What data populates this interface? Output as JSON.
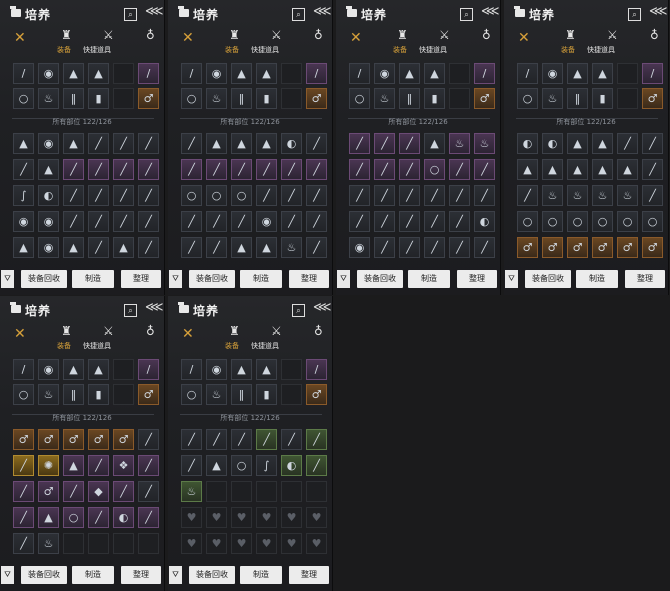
{
  "window_title": "培养",
  "categories": {
    "tab_equipment": "装备",
    "tab_quick_items": "快捷道具"
  },
  "capacity_label": "所有部位 122/126",
  "footer": {
    "recycle_label": "装备回收",
    "craft_label": "制造",
    "sort_label": "整理"
  },
  "icons": {
    "x": "✕",
    "armor": "♜",
    "sword": "⚔",
    "gourd": "♁",
    "search": "⌕",
    "collapse": "⋘",
    "filter": "⛛"
  },
  "colors": {
    "accent": "#d6a03a",
    "panel_bg": "#1f2023",
    "button_bg": "#ececec"
  },
  "panels": [
    {
      "equipped": [
        {
          "t": "dark",
          "g": "/"
        },
        {
          "t": "dark",
          "g": "◉"
        },
        {
          "t": "dark",
          "g": "▲"
        },
        {
          "t": "dark",
          "g": "▲"
        },
        {
          "t": "empty",
          "g": ""
        },
        {
          "t": "purple",
          "g": "/"
        },
        {
          "t": "dark",
          "g": "○"
        },
        {
          "t": "dark",
          "g": "♨"
        },
        {
          "t": "dark",
          "g": "‖"
        },
        {
          "t": "dark",
          "g": "▮"
        },
        {
          "t": "empty",
          "g": ""
        },
        {
          "t": "orange",
          "g": "♂"
        }
      ],
      "inventory": [
        {
          "t": "dark",
          "g": "▲"
        },
        {
          "t": "dark",
          "g": "◉"
        },
        {
          "t": "dark",
          "g": "▲"
        },
        {
          "t": "dark",
          "g": "╱"
        },
        {
          "t": "dark",
          "g": "╱"
        },
        {
          "t": "dark",
          "g": "╱"
        },
        {
          "t": "dark",
          "g": "╱"
        },
        {
          "t": "dark",
          "g": "▲"
        },
        {
          "t": "purple",
          "g": "╱"
        },
        {
          "t": "purple",
          "g": "╱"
        },
        {
          "t": "purple",
          "g": "╱"
        },
        {
          "t": "purple",
          "g": "╱"
        },
        {
          "t": "dark",
          "g": "∫"
        },
        {
          "t": "dark",
          "g": "◐"
        },
        {
          "t": "dark",
          "g": "╱"
        },
        {
          "t": "dark",
          "g": "╱"
        },
        {
          "t": "dark",
          "g": "╱"
        },
        {
          "t": "dark",
          "g": "╱"
        },
        {
          "t": "dark",
          "g": "◉"
        },
        {
          "t": "dark",
          "g": "◉"
        },
        {
          "t": "dark",
          "g": "╱"
        },
        {
          "t": "dark",
          "g": "╱"
        },
        {
          "t": "dark",
          "g": "╱"
        },
        {
          "t": "dark",
          "g": "╱"
        },
        {
          "t": "dark",
          "g": "▲"
        },
        {
          "t": "dark",
          "g": "◉"
        },
        {
          "t": "dark",
          "g": "▲"
        },
        {
          "t": "dark",
          "g": "╱"
        },
        {
          "t": "dark",
          "g": "▲"
        },
        {
          "t": "dark",
          "g": "╱"
        }
      ]
    },
    {
      "equipped": [
        {
          "t": "dark",
          "g": "/"
        },
        {
          "t": "dark",
          "g": "◉"
        },
        {
          "t": "dark",
          "g": "▲"
        },
        {
          "t": "dark",
          "g": "▲"
        },
        {
          "t": "empty",
          "g": ""
        },
        {
          "t": "purple",
          "g": "/"
        },
        {
          "t": "dark",
          "g": "○"
        },
        {
          "t": "dark",
          "g": "♨"
        },
        {
          "t": "dark",
          "g": "‖"
        },
        {
          "t": "dark",
          "g": "▮"
        },
        {
          "t": "empty",
          "g": ""
        },
        {
          "t": "orange",
          "g": "♂"
        }
      ],
      "inventory": [
        {
          "t": "dark",
          "g": "╱"
        },
        {
          "t": "dark",
          "g": "▲"
        },
        {
          "t": "dark",
          "g": "▲"
        },
        {
          "t": "dark",
          "g": "▲"
        },
        {
          "t": "dark",
          "g": "◐"
        },
        {
          "t": "dark",
          "g": "╱"
        },
        {
          "t": "purple",
          "g": "╱"
        },
        {
          "t": "purple",
          "g": "╱"
        },
        {
          "t": "purple",
          "g": "╱"
        },
        {
          "t": "purple",
          "g": "╱"
        },
        {
          "t": "purple",
          "g": "╱"
        },
        {
          "t": "purple",
          "g": "╱"
        },
        {
          "t": "dark",
          "g": "○"
        },
        {
          "t": "dark",
          "g": "○"
        },
        {
          "t": "dark",
          "g": "○"
        },
        {
          "t": "dark",
          "g": "╱"
        },
        {
          "t": "dark",
          "g": "╱"
        },
        {
          "t": "dark",
          "g": "╱"
        },
        {
          "t": "dark",
          "g": "╱"
        },
        {
          "t": "dark",
          "g": "╱"
        },
        {
          "t": "dark",
          "g": "╱"
        },
        {
          "t": "dark",
          "g": "◉"
        },
        {
          "t": "dark",
          "g": "╱"
        },
        {
          "t": "dark",
          "g": "╱"
        },
        {
          "t": "dark",
          "g": "╱"
        },
        {
          "t": "dark",
          "g": "╱"
        },
        {
          "t": "dark",
          "g": "▲"
        },
        {
          "t": "dark",
          "g": "▲"
        },
        {
          "t": "dark",
          "g": "♨"
        },
        {
          "t": "dark",
          "g": "╱"
        }
      ]
    },
    {
      "equipped": [
        {
          "t": "dark",
          "g": "/"
        },
        {
          "t": "dark",
          "g": "◉"
        },
        {
          "t": "dark",
          "g": "▲"
        },
        {
          "t": "dark",
          "g": "▲"
        },
        {
          "t": "empty",
          "g": ""
        },
        {
          "t": "purple",
          "g": "/"
        },
        {
          "t": "dark",
          "g": "○"
        },
        {
          "t": "dark",
          "g": "♨"
        },
        {
          "t": "dark",
          "g": "‖"
        },
        {
          "t": "dark",
          "g": "▮"
        },
        {
          "t": "empty",
          "g": ""
        },
        {
          "t": "orange",
          "g": "♂"
        }
      ],
      "inventory": [
        {
          "t": "purple",
          "g": "╱"
        },
        {
          "t": "purple",
          "g": "╱"
        },
        {
          "t": "purple",
          "g": "╱"
        },
        {
          "t": "dark",
          "g": "▲"
        },
        {
          "t": "purple",
          "g": "♨"
        },
        {
          "t": "purple",
          "g": "♨"
        },
        {
          "t": "purple",
          "g": "╱"
        },
        {
          "t": "purple",
          "g": "╱"
        },
        {
          "t": "purple",
          "g": "╱"
        },
        {
          "t": "purple",
          "g": "○"
        },
        {
          "t": "purple",
          "g": "╱"
        },
        {
          "t": "purple",
          "g": "╱"
        },
        {
          "t": "dark",
          "g": "╱"
        },
        {
          "t": "dark",
          "g": "╱"
        },
        {
          "t": "dark",
          "g": "╱"
        },
        {
          "t": "dark",
          "g": "╱"
        },
        {
          "t": "dark",
          "g": "╱"
        },
        {
          "t": "dark",
          "g": "╱"
        },
        {
          "t": "dark",
          "g": "╱"
        },
        {
          "t": "dark",
          "g": "╱"
        },
        {
          "t": "dark",
          "g": "╱"
        },
        {
          "t": "dark",
          "g": "╱"
        },
        {
          "t": "dark",
          "g": "╱"
        },
        {
          "t": "dark",
          "g": "◐"
        },
        {
          "t": "dark",
          "g": "◉"
        },
        {
          "t": "dark",
          "g": "╱"
        },
        {
          "t": "dark",
          "g": "╱"
        },
        {
          "t": "dark",
          "g": "╱"
        },
        {
          "t": "dark",
          "g": "╱"
        },
        {
          "t": "dark",
          "g": "╱"
        }
      ]
    },
    {
      "equipped": [
        {
          "t": "dark",
          "g": "/"
        },
        {
          "t": "dark",
          "g": "◉"
        },
        {
          "t": "dark",
          "g": "▲"
        },
        {
          "t": "dark",
          "g": "▲"
        },
        {
          "t": "empty",
          "g": ""
        },
        {
          "t": "purple",
          "g": "/"
        },
        {
          "t": "dark",
          "g": "○"
        },
        {
          "t": "dark",
          "g": "♨"
        },
        {
          "t": "dark",
          "g": "‖"
        },
        {
          "t": "dark",
          "g": "▮"
        },
        {
          "t": "empty",
          "g": ""
        },
        {
          "t": "orange",
          "g": "♂"
        }
      ],
      "inventory": [
        {
          "t": "dark",
          "g": "◐"
        },
        {
          "t": "dark",
          "g": "◐"
        },
        {
          "t": "dark",
          "g": "▲"
        },
        {
          "t": "dark",
          "g": "▲"
        },
        {
          "t": "dark",
          "g": "╱"
        },
        {
          "t": "dark",
          "g": "╱"
        },
        {
          "t": "dark",
          "g": "▲"
        },
        {
          "t": "dark",
          "g": "▲"
        },
        {
          "t": "dark",
          "g": "▲"
        },
        {
          "t": "dark",
          "g": "▲"
        },
        {
          "t": "dark",
          "g": "▲"
        },
        {
          "t": "dark",
          "g": "╱"
        },
        {
          "t": "dark",
          "g": "╱"
        },
        {
          "t": "dark",
          "g": "♨"
        },
        {
          "t": "dark",
          "g": "♨"
        },
        {
          "t": "dark",
          "g": "♨"
        },
        {
          "t": "dark",
          "g": "♨"
        },
        {
          "t": "dark",
          "g": "╱"
        },
        {
          "t": "dark",
          "g": "○"
        },
        {
          "t": "dark",
          "g": "○"
        },
        {
          "t": "dark",
          "g": "○"
        },
        {
          "t": "dark",
          "g": "○"
        },
        {
          "t": "dark",
          "g": "○"
        },
        {
          "t": "dark",
          "g": "○"
        },
        {
          "t": "orange",
          "g": "♂"
        },
        {
          "t": "orange",
          "g": "♂"
        },
        {
          "t": "orange",
          "g": "♂"
        },
        {
          "t": "orange",
          "g": "♂"
        },
        {
          "t": "orange",
          "g": "♂"
        },
        {
          "t": "orange",
          "g": "♂"
        }
      ]
    },
    {
      "equipped": [
        {
          "t": "dark",
          "g": "/"
        },
        {
          "t": "dark",
          "g": "◉"
        },
        {
          "t": "dark",
          "g": "▲"
        },
        {
          "t": "dark",
          "g": "▲"
        },
        {
          "t": "empty",
          "g": ""
        },
        {
          "t": "purple",
          "g": "/"
        },
        {
          "t": "dark",
          "g": "○"
        },
        {
          "t": "dark",
          "g": "♨"
        },
        {
          "t": "dark",
          "g": "‖"
        },
        {
          "t": "dark",
          "g": "▮"
        },
        {
          "t": "empty",
          "g": ""
        },
        {
          "t": "orange",
          "g": "♂"
        }
      ],
      "inventory": [
        {
          "t": "orange",
          "g": "♂"
        },
        {
          "t": "orange",
          "g": "♂"
        },
        {
          "t": "orange",
          "g": "♂"
        },
        {
          "t": "orange",
          "g": "♂"
        },
        {
          "t": "orange",
          "g": "♂"
        },
        {
          "t": "dark",
          "g": "╱"
        },
        {
          "t": "gold",
          "g": "╱"
        },
        {
          "t": "gold",
          "g": "✺"
        },
        {
          "t": "purple",
          "g": "▲"
        },
        {
          "t": "purple",
          "g": "╱"
        },
        {
          "t": "purple",
          "g": "❖"
        },
        {
          "t": "purple",
          "g": "╱"
        },
        {
          "t": "purple",
          "g": "╱"
        },
        {
          "t": "purple",
          "g": "♂"
        },
        {
          "t": "purple",
          "g": "╱"
        },
        {
          "t": "purple",
          "g": "◆"
        },
        {
          "t": "purple",
          "g": "╱"
        },
        {
          "t": "dark",
          "g": "╱"
        },
        {
          "t": "purple",
          "g": "╱"
        },
        {
          "t": "purple",
          "g": "▲"
        },
        {
          "t": "purple",
          "g": "○"
        },
        {
          "t": "purple",
          "g": "╱"
        },
        {
          "t": "purple",
          "g": "◐"
        },
        {
          "t": "purple",
          "g": "╱"
        },
        {
          "t": "dark",
          "g": "╱"
        },
        {
          "t": "dark",
          "g": "♨"
        },
        {
          "t": "empty",
          "g": ""
        },
        {
          "t": "empty",
          "g": ""
        },
        {
          "t": "empty",
          "g": ""
        },
        {
          "t": "empty",
          "g": ""
        }
      ]
    },
    {
      "equipped": [
        {
          "t": "dark",
          "g": "/"
        },
        {
          "t": "dark",
          "g": "◉"
        },
        {
          "t": "dark",
          "g": "▲"
        },
        {
          "t": "dark",
          "g": "▲"
        },
        {
          "t": "empty",
          "g": ""
        },
        {
          "t": "purple",
          "g": "/"
        },
        {
          "t": "dark",
          "g": "○"
        },
        {
          "t": "dark",
          "g": "♨"
        },
        {
          "t": "dark",
          "g": "‖"
        },
        {
          "t": "dark",
          "g": "▮"
        },
        {
          "t": "empty",
          "g": ""
        },
        {
          "t": "orange",
          "g": "♂"
        }
      ],
      "inventory": [
        {
          "t": "dark",
          "g": "╱"
        },
        {
          "t": "dark",
          "g": "╱"
        },
        {
          "t": "dark",
          "g": "╱"
        },
        {
          "t": "green",
          "g": "╱"
        },
        {
          "t": "dark",
          "g": "╱"
        },
        {
          "t": "green",
          "g": "╱"
        },
        {
          "t": "dark",
          "g": "╱"
        },
        {
          "t": "dark",
          "g": "▲"
        },
        {
          "t": "dark",
          "g": "○"
        },
        {
          "t": "dark",
          "g": "∫"
        },
        {
          "t": "green",
          "g": "◐"
        },
        {
          "t": "green",
          "g": "╱"
        },
        {
          "t": "green",
          "g": "♨"
        },
        {
          "t": "empty",
          "g": ""
        },
        {
          "t": "empty",
          "g": ""
        },
        {
          "t": "empty",
          "g": ""
        },
        {
          "t": "empty",
          "g": ""
        },
        {
          "t": "empty",
          "g": ""
        },
        {
          "t": "empty",
          "g": "♥"
        },
        {
          "t": "empty",
          "g": "♥"
        },
        {
          "t": "empty",
          "g": "♥"
        },
        {
          "t": "empty",
          "g": "♥"
        },
        {
          "t": "empty",
          "g": "♥"
        },
        {
          "t": "empty",
          "g": "♥"
        },
        {
          "t": "empty",
          "g": "♥"
        },
        {
          "t": "empty",
          "g": "♥"
        },
        {
          "t": "empty",
          "g": "♥"
        },
        {
          "t": "empty",
          "g": "♥"
        },
        {
          "t": "empty",
          "g": "♥"
        },
        {
          "t": "empty",
          "g": "♥"
        }
      ]
    }
  ]
}
